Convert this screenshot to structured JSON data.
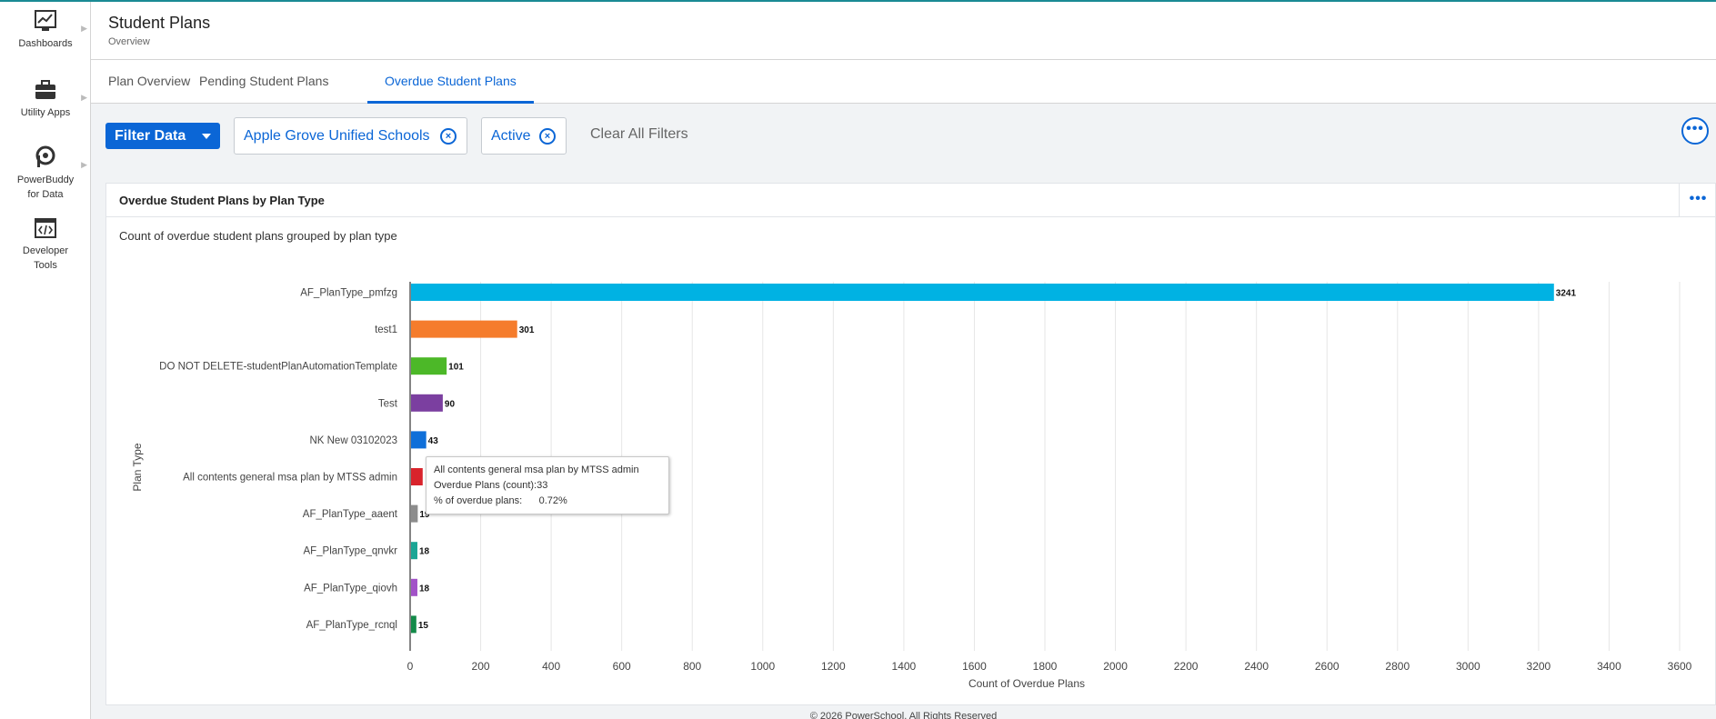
{
  "nav": [
    {
      "label": "Dashboards",
      "icon": "dashboards-icon"
    },
    {
      "label": "Utility Apps",
      "icon": "briefcase-icon"
    },
    {
      "label": "PowerBuddy for Data",
      "label_line1": "PowerBuddy",
      "label_line2": "for Data",
      "icon": "powerbuddy-icon"
    },
    {
      "label": "Developer Tools",
      "label_line1": "Developer",
      "label_line2": "Tools",
      "icon": "code-icon"
    }
  ],
  "header": {
    "title": "Student Plans",
    "subtitle": "Overview"
  },
  "tabs": [
    {
      "label": "Plan Overview",
      "active": false
    },
    {
      "label": "Pending Student Plans",
      "active": false
    },
    {
      "label": "Overdue Student Plans",
      "active": true
    }
  ],
  "filters": {
    "button_label": "Filter Data",
    "chips": [
      {
        "label": "Apple Grove Unified Schools",
        "remove": "×"
      },
      {
        "label": "Active",
        "remove": "×"
      }
    ],
    "clear_all": "Clear All Filters",
    "more": "•••"
  },
  "card": {
    "title": "Overdue Student Plans by Plan Type",
    "description": "Count of overdue student plans grouped by plan type",
    "more": "•••"
  },
  "chart_data": {
    "type": "bar",
    "orientation": "horizontal",
    "categories": [
      "AF_PlanType_pmfzg",
      "test1",
      "DO NOT DELETE-studentPlanAutomationTemplate",
      "Test",
      "NK New 03102023",
      "All contents general msa plan by MTSS admin",
      "AF_PlanType_aaent",
      "AF_PlanType_qnvkr",
      "AF_PlanType_qiovh",
      "AF_PlanType_rcnql"
    ],
    "values": [
      3241,
      301,
      101,
      90,
      43,
      33,
      19,
      18,
      18,
      15
    ],
    "data_labels": [
      "3241",
      "301",
      "101",
      "90",
      "43",
      "",
      "19",
      "18",
      "18",
      "15"
    ],
    "colors": [
      "#00b2e3",
      "#f57c2c",
      "#4cb828",
      "#7b3fa0",
      "#0f6fd9",
      "#d9232b",
      "#8c8c8c",
      "#1aa595",
      "#a252c8",
      "#138a49"
    ],
    "xlabel": "Count of Overdue Plans",
    "ylabel": "Plan Type",
    "xlim": [
      0,
      3600
    ],
    "xticks": [
      0,
      200,
      400,
      600,
      800,
      1000,
      1200,
      1400,
      1600,
      1800,
      2000,
      2200,
      2400,
      2600,
      2800,
      3000,
      3200,
      3400,
      3600
    ],
    "grid": true
  },
  "tooltip": {
    "title": "All contents general msa plan by MTSS admin",
    "count_label": "Overdue Plans (count):",
    "count_value": "33",
    "pct_label": "% of overdue plans:",
    "pct_value": "0.72%"
  },
  "footer": "© 2026 PowerSchool. All Rights Reserved"
}
